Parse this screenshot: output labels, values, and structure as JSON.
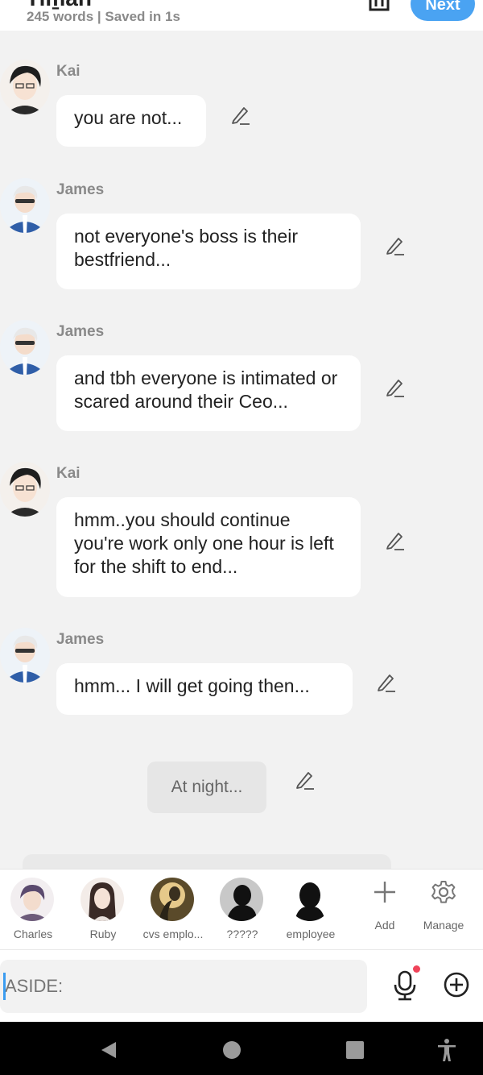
{
  "header": {
    "title_partial": "Ti̇m̱an",
    "word_status": "245 words | Saved in 1s",
    "next_label": "Next"
  },
  "messages": [
    {
      "speaker": "Kai",
      "text": "you are not..."
    },
    {
      "speaker": "James",
      "text": "not everyone's boss is their bestfriend..."
    },
    {
      "speaker": "James",
      "text": "and tbh everyone is intimated or scared around their Ceo..."
    },
    {
      "speaker": "Kai",
      "text": "hmm..you should continue you're work only one hour is left for the shift to end..."
    },
    {
      "speaker": "James",
      "text": "hmm... I will get going then..."
    }
  ],
  "narration": "At night...",
  "cast": [
    {
      "name": "Charles"
    },
    {
      "name": "Ruby"
    },
    {
      "name": "cvs emplo..."
    },
    {
      "name": "?????"
    },
    {
      "name": "employee"
    }
  ],
  "cast_actions": {
    "add_label": "Add",
    "manage_label": "Manage"
  },
  "input": {
    "placeholder": "ASIDE:"
  },
  "colors": {
    "accent": "#4aa3f2",
    "background": "#f2f2f2",
    "notification": "#f0445a"
  }
}
